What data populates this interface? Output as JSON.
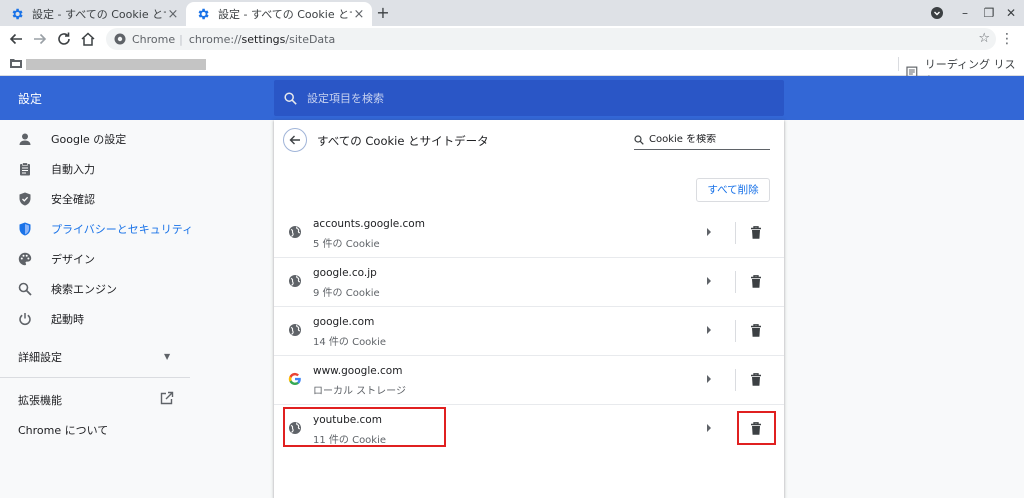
{
  "tabs": [
    {
      "title": "設定 - すべての Cookie とサイト",
      "close": "×"
    },
    {
      "title": "設定 - すべての Cookie とサイト",
      "close": "×"
    }
  ],
  "new_tab": "+",
  "window_controls": [
    "–",
    "❐",
    "✕"
  ],
  "omnibox": {
    "origin_label": "Chrome",
    "url_scheme": "chrome://",
    "url_host": "settings",
    "url_path": "/siteData"
  },
  "bookmarks_bar": {
    "reading_list": "リーディング リスト"
  },
  "settings": {
    "title": "設定",
    "search_placeholder": "設定項目を検索"
  },
  "sidebar": {
    "items": [
      {
        "label": "Google の設定",
        "icon": "person-icon"
      },
      {
        "label": "自動入力",
        "icon": "clipboard-icon"
      },
      {
        "label": "安全確認",
        "icon": "shield-check-icon"
      },
      {
        "label": "プライバシーとセキュリティ",
        "icon": "shield-icon",
        "active": true
      },
      {
        "label": "デザイン",
        "icon": "palette-icon"
      },
      {
        "label": "検索エンジン",
        "icon": "search-icon"
      },
      {
        "label": "起動時",
        "icon": "power-icon"
      }
    ],
    "advanced": "詳細設定",
    "extensions": "拡張機能",
    "about": "Chrome について"
  },
  "page": {
    "title": "すべての Cookie とサイトデータ",
    "search_placeholder": "Cookie を検索",
    "delete_all": "すべて削除"
  },
  "sites": [
    {
      "name": "accounts.google.com",
      "detail": "5 件の Cookie",
      "icon": "globe-icon"
    },
    {
      "name": "google.co.jp",
      "detail": "9 件の Cookie",
      "icon": "globe-icon"
    },
    {
      "name": "google.com",
      "detail": "14 件の Cookie",
      "icon": "globe-icon"
    },
    {
      "name": "www.google.com",
      "detail": "ローカル ストレージ",
      "icon": "google-g-icon"
    },
    {
      "name": "youtube.com",
      "detail": "11 件の Cookie",
      "icon": "globe-icon"
    }
  ],
  "colors": {
    "header_blue": "#3367d6",
    "accent_blue": "#1a73e8",
    "highlight_red": "#e02020"
  }
}
